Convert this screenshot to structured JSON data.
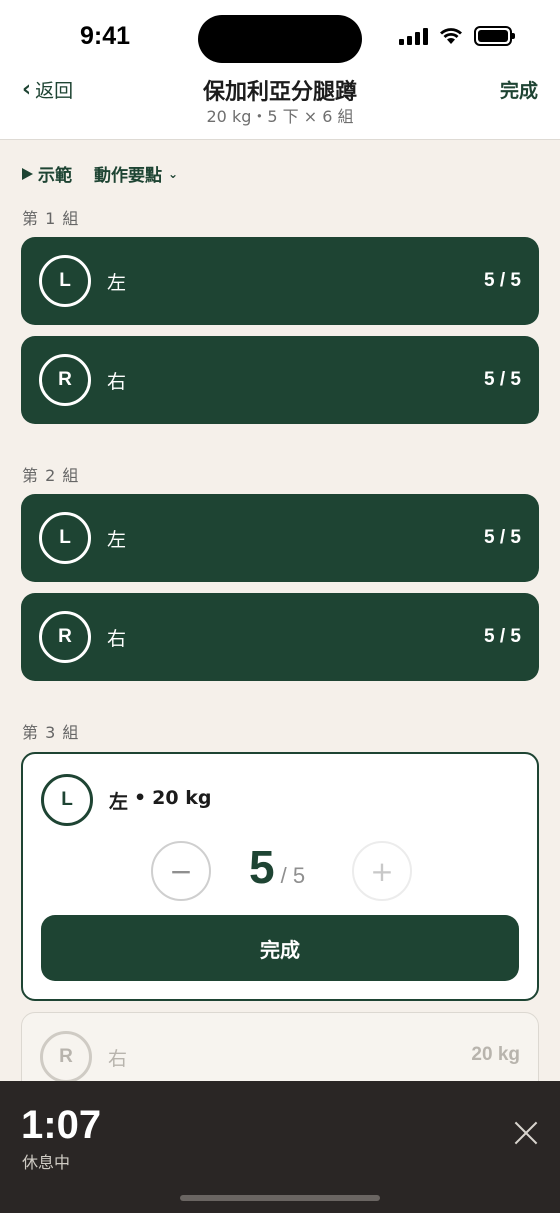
{
  "status_bar": {
    "time": "9:41"
  },
  "nav": {
    "back_label": "返回",
    "title": "保加利亞分腿蹲",
    "subtitle": "20 kg・5 下 × 6 組",
    "done_label": "完成"
  },
  "toolbar": {
    "demo_label": "示範",
    "tips_label": "動作要點"
  },
  "sets": [
    {
      "label": "第 1 組",
      "sides": [
        {
          "badge": "L",
          "name": "左",
          "reps": "5 / 5"
        },
        {
          "badge": "R",
          "name": "右",
          "reps": "5 / 5"
        }
      ]
    },
    {
      "label": "第 2 組",
      "sides": [
        {
          "badge": "L",
          "name": "左",
          "reps": "5 / 5"
        },
        {
          "badge": "R",
          "name": "右",
          "reps": "5 / 5"
        }
      ]
    },
    {
      "label": "第 3 組",
      "active": {
        "badge": "L",
        "name": "左",
        "separator": "•",
        "weight": "20 kg",
        "minus": "−",
        "plus": "+",
        "current_reps": "5",
        "total_reps": "/ 5",
        "complete_label": "完成"
      },
      "pending": {
        "badge": "R",
        "name": "右",
        "weight": "20 kg"
      }
    }
  ],
  "rest": {
    "time": "1:07",
    "label": "休息中"
  },
  "colors": {
    "accent": "#1e4433",
    "background": "#f5f0ea",
    "rest_bar": "#2a2625"
  }
}
